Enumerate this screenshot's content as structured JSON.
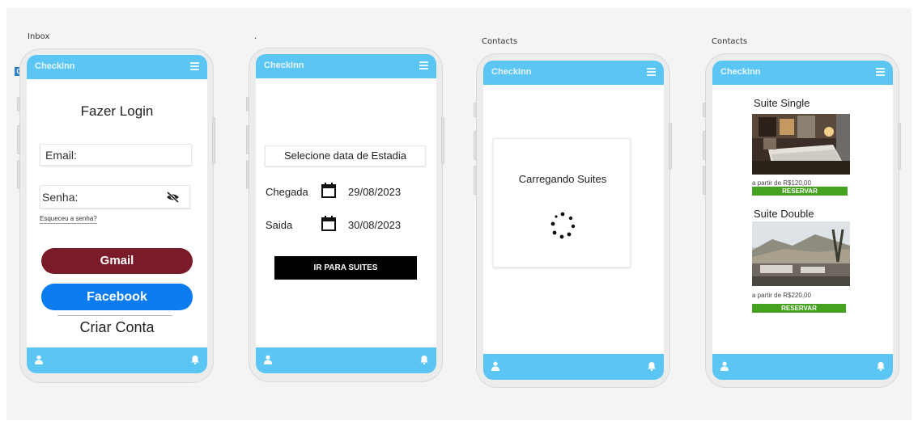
{
  "frames": [
    {
      "label": "Inbox"
    },
    {
      "label": "."
    },
    {
      "label": "Contacts"
    },
    {
      "label": "Contacts"
    }
  ],
  "badge": "O",
  "app": {
    "title": "CheckInn"
  },
  "login": {
    "heading": "Fazer Login",
    "email_placeholder": "Email:",
    "password_placeholder": "Senha:",
    "forgot": "Esqueceu a senha?",
    "gmail": "Gmail",
    "facebook": "Facebook",
    "create": "Criar Conta"
  },
  "dates": {
    "heading": "Selecione data de Estadia",
    "arrival_label": "Chegada",
    "arrival_date": "29/08/2023",
    "departure_label": "Saida",
    "departure_date": "30/08/2023",
    "button": "IR PARA SUITES"
  },
  "loading": {
    "text": "Carregando Suites"
  },
  "suites": [
    {
      "name": "Suite Single",
      "price": "a partir de R$120,00",
      "button": "RESERVAR"
    },
    {
      "name": "Suite Double",
      "price": "a partir de R$220,00",
      "button": "RESERVAR"
    }
  ],
  "colors": {
    "accent": "#5bc5f4",
    "gmail": "#7b1a28",
    "facebook": "#0a7cf0",
    "reserve": "#45a11f"
  }
}
